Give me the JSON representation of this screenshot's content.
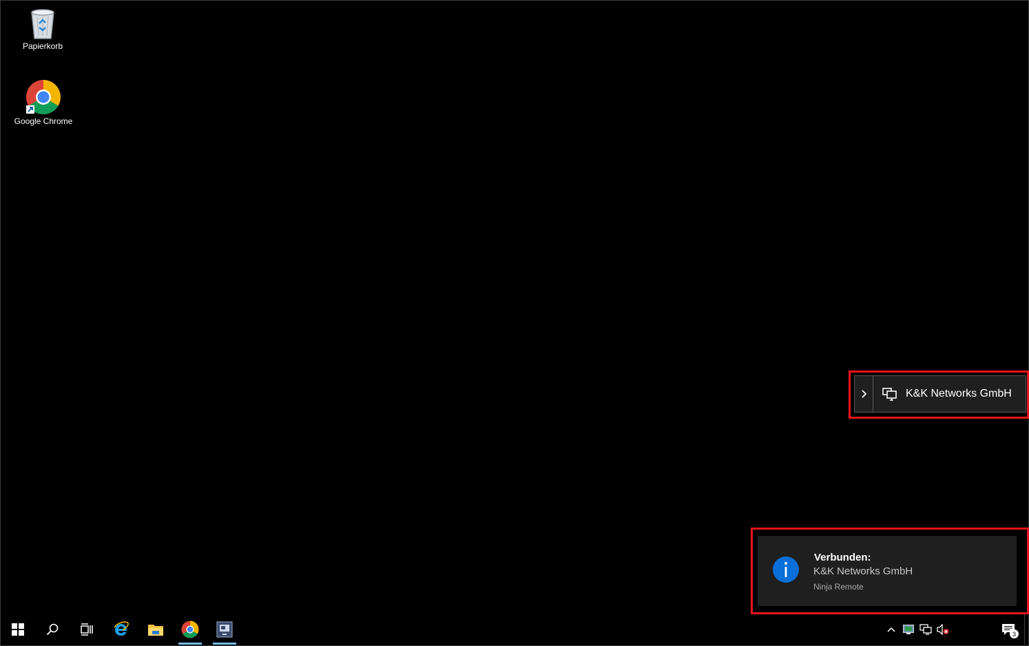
{
  "desktop": {
    "icons": [
      {
        "label": "Papierkorb",
        "icon": "recycle-bin-icon"
      },
      {
        "label": "Google Chrome",
        "icon": "chrome-icon"
      }
    ]
  },
  "connection_bar": {
    "label": "K&K Networks GmbH",
    "expand_icon": "chevron-right-icon",
    "icon": "remote-monitor-icon"
  },
  "toast": {
    "title": "Verbunden:",
    "body": "K&K Networks GmbH",
    "source": "Ninja Remote",
    "icon": "info-icon",
    "icon_color": "#0a6fd8"
  },
  "taskbar": {
    "buttons": [
      {
        "icon": "windows-start-icon"
      },
      {
        "icon": "search-icon"
      },
      {
        "icon": "task-view-icon"
      },
      {
        "icon": "internet-explorer-icon"
      },
      {
        "icon": "file-explorer-icon"
      },
      {
        "icon": "chrome-icon",
        "active": true
      },
      {
        "icon": "remote-session-icon",
        "active": true
      }
    ],
    "tray": [
      {
        "icon": "chevron-up-icon"
      },
      {
        "icon": "ninja-agent-icon"
      },
      {
        "icon": "network-icon"
      },
      {
        "icon": "volume-muted-icon"
      }
    ],
    "notification_count": "3"
  },
  "colors": {
    "highlight": "#e8141c",
    "taskbar_active": "#76b9ed"
  }
}
